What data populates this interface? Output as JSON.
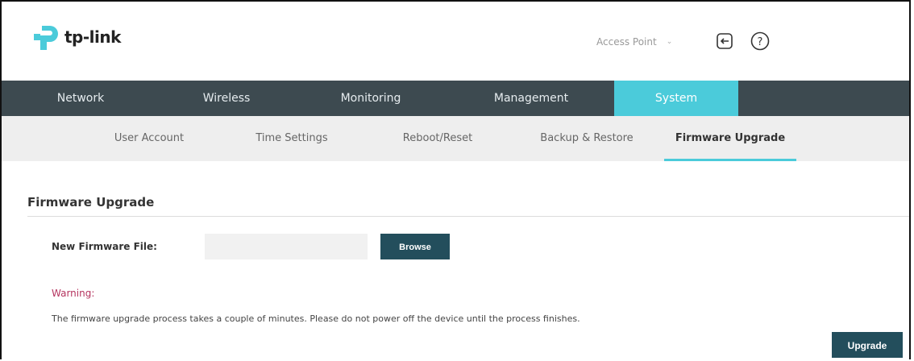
{
  "brand": {
    "name": "tp-link",
    "accent_color": "#4bcbda",
    "nav_color": "#3d4a50",
    "button_color": "#234e5c",
    "logo_color": "#4bcbda"
  },
  "header": {
    "mode_selected": "Access Point",
    "logout_icon": "logout-icon",
    "help_icon": "help-icon"
  },
  "main_nav": {
    "items": [
      {
        "label": "Network"
      },
      {
        "label": "Wireless"
      },
      {
        "label": "Monitoring"
      },
      {
        "label": "Management"
      },
      {
        "label": "System"
      }
    ],
    "active": "System"
  },
  "sub_nav": {
    "items": [
      {
        "label": "User Account"
      },
      {
        "label": "Time Settings"
      },
      {
        "label": "Reboot/Reset"
      },
      {
        "label": "Backup & Restore"
      },
      {
        "label": "Firmware Upgrade"
      }
    ],
    "active": "Firmware Upgrade"
  },
  "content": {
    "section_title": "Firmware Upgrade",
    "file_label": "New Firmware File:",
    "file_value": "",
    "browse_label": "Browse",
    "warning_label": "Warning:",
    "warning_color": "#b5345f",
    "warning_text": "The firmware upgrade process takes a couple of minutes. Please do not power off the device until the process finishes.",
    "upgrade_label": "Upgrade"
  }
}
